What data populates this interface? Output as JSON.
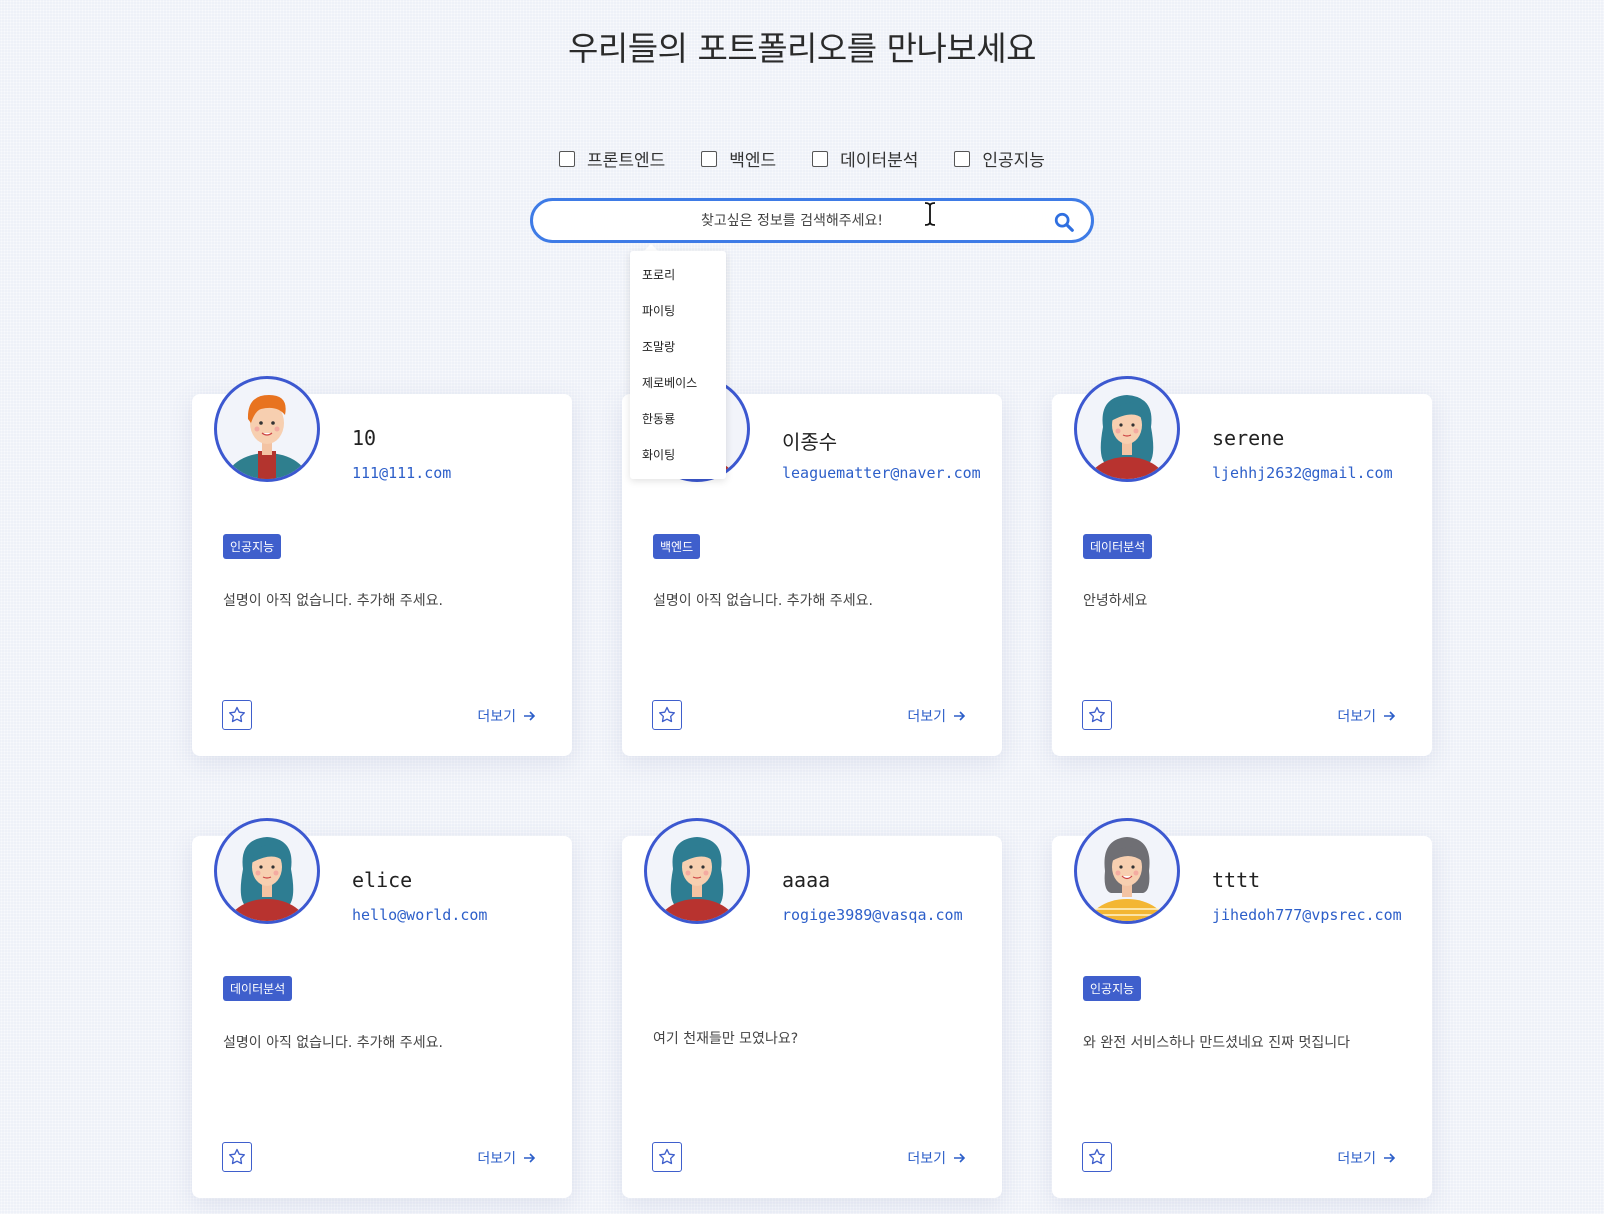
{
  "title": "우리들의 포트폴리오를 만나보세요",
  "filters": [
    {
      "label": "프론트엔드",
      "checked": false
    },
    {
      "label": "백엔드",
      "checked": false
    },
    {
      "label": "데이터분석",
      "checked": false
    },
    {
      "label": "인공지능",
      "checked": false
    }
  ],
  "search": {
    "placeholder": "찾고싶은 정보를 검색해주세요!",
    "value": ""
  },
  "suggestions": [
    "포로리",
    "파이팅",
    "조말랑",
    "제로베이스",
    "한동룡",
    "화이팅"
  ],
  "more_label": "더보기",
  "colors": {
    "accent": "#3f5fcc",
    "link": "#2d5fc9",
    "search_border": "#3e7be6"
  },
  "cards": [
    {
      "name": "10",
      "email": "111@111.com",
      "tag": "인공지능",
      "description": "설명이 아직 없습니다. 추가해 주세요.",
      "avatar": "avatar-orange-hair-man"
    },
    {
      "name": "이종수",
      "email": "leaguematter@naver.com",
      "tag": "백엔드",
      "description": "설명이 아직 없습니다. 추가해 주세요.",
      "avatar": "avatar-teal-hair-woman"
    },
    {
      "name": "serene",
      "email": "ljehhj2632@gmail.com",
      "tag": "데이터분석",
      "description": "안녕하세요",
      "avatar": "avatar-teal-hair-woman"
    },
    {
      "name": "elice",
      "email": "hello@world.com",
      "tag": "데이터분석",
      "description": "설명이 아직 없습니다. 추가해 주세요.",
      "avatar": "avatar-teal-hair-woman"
    },
    {
      "name": "aaaa",
      "email": "rogige3989@vasqa.com",
      "tag": "",
      "description": "여기 천재들만 모였나요?",
      "avatar": "avatar-teal-hair-woman"
    },
    {
      "name": "tttt",
      "email": "jihedoh777@vpsrec.com",
      "tag": "인공지능",
      "description": "와 완전 서비스하나 만드셨네요 진짜 멋집니다",
      "avatar": "avatar-gray-hair-woman"
    }
  ]
}
